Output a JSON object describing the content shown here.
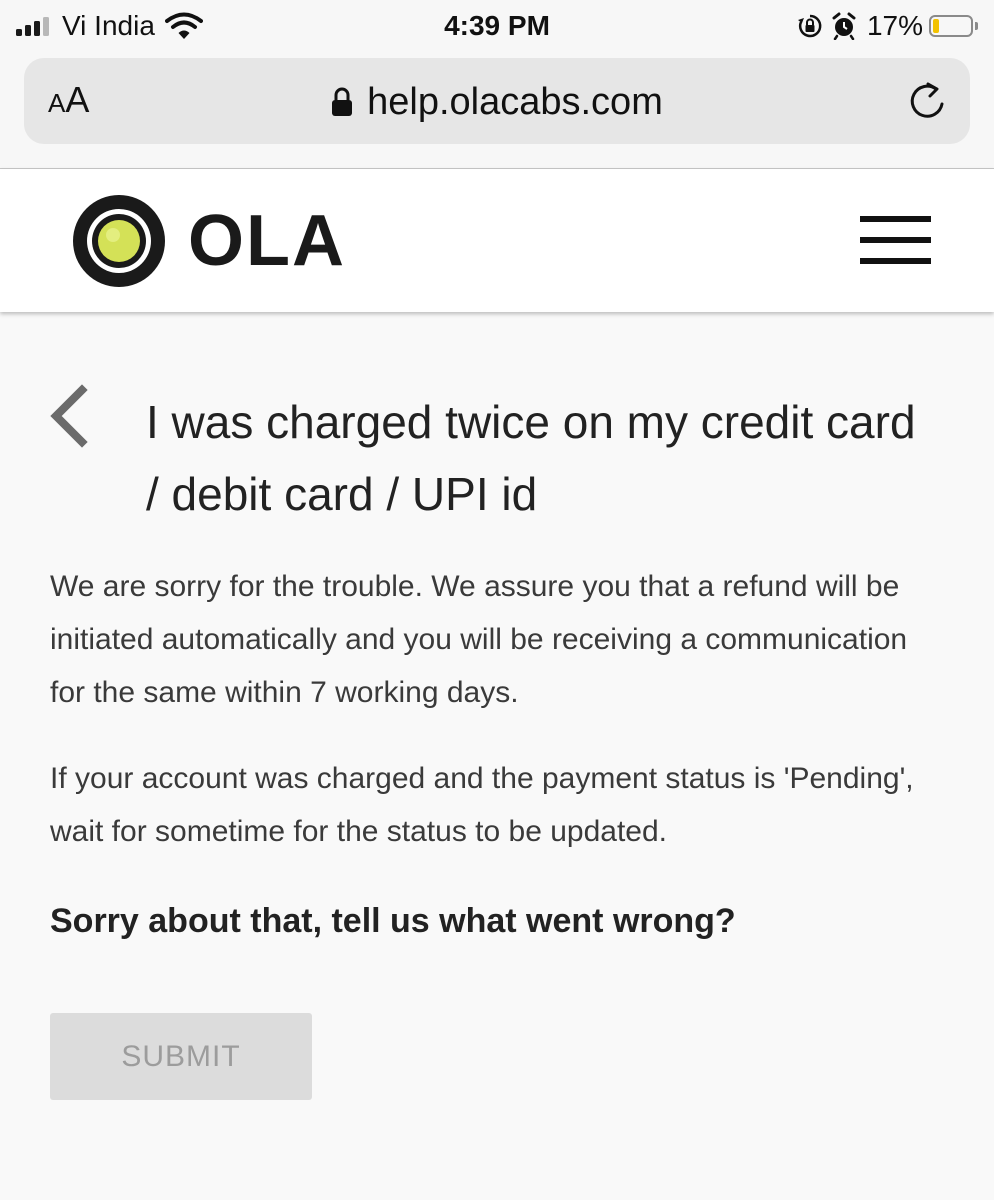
{
  "status_bar": {
    "carrier": "Vi India",
    "time": "4:39 PM",
    "battery_percent": "17%",
    "battery_level": 0.17,
    "icons": [
      "signal-icon",
      "wifi-icon",
      "orientation-lock-icon",
      "alarm-icon",
      "battery-icon"
    ]
  },
  "browser": {
    "reader_small": "A",
    "reader_large": "A",
    "url": "help.olacabs.com",
    "icons": [
      "lock-icon",
      "reload-icon"
    ]
  },
  "header": {
    "logo_text": "OLA",
    "logo_colors": {
      "ring": "#1a1a1a",
      "dot": "#d4e157"
    },
    "icons": [
      "ola-logo-icon",
      "hamburger-menu-icon"
    ]
  },
  "article": {
    "title": "I was charged twice on my credit card / debit card / UPI id",
    "paragraphs": [
      "We are sorry for the trouble. We assure you that a refund will be initiated automatically and you will be receiving a communication for the same within 7 working days.",
      "If your account was charged and the payment status is 'Pending', wait for sometime for the status to be updated."
    ],
    "feedback_question": "Sorry about that, tell us what went wrong?",
    "submit_label": "SUBMIT",
    "icons": [
      "back-chevron-icon"
    ]
  }
}
